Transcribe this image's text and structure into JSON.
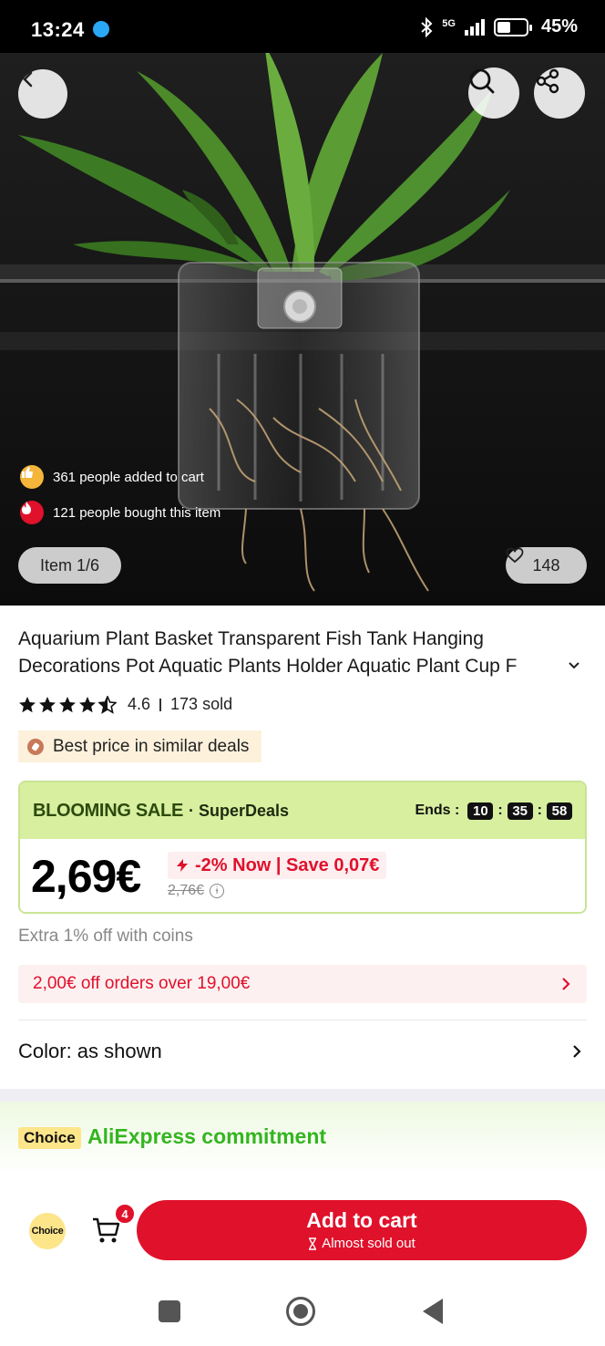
{
  "status_bar": {
    "time": "13:24",
    "network": "5G",
    "battery": "45%"
  },
  "gallery": {
    "social_proof": [
      {
        "icon": "thumbs-up-icon",
        "text": "361 people added to cart"
      },
      {
        "icon": "fire-icon",
        "text": "121 people bought this item"
      }
    ],
    "item_counter": "Item 1/6",
    "wishlist_count": "148"
  },
  "product": {
    "title": "Aquarium Plant Basket Transparent Fish Tank Hanging Decorations Pot Aquatic Plants Holder Aquatic Plant Cup F",
    "rating": "4.6",
    "rating_value": 4.6,
    "sold": "173 sold",
    "best_price_badge": "Best price in similar deals"
  },
  "sale": {
    "name": "BLOOMING SALE",
    "subtitle": "· SuperDeals",
    "ends_label": "Ends :",
    "timer": [
      "10",
      "35",
      "58"
    ],
    "price": "2,69€",
    "discount": "-2% Now | Save 0,07€",
    "old_price": "2,76€"
  },
  "offers": {
    "coins": "Extra 1% off with coins",
    "coupon": "2,00€ off orders over 19,00€"
  },
  "variant": {
    "color": "Color: as shown"
  },
  "commitment": {
    "tag": "Choice",
    "text": "AliExpress commitment"
  },
  "action_bar": {
    "choice_label": "Choice",
    "cart_count": "4",
    "add_to_cart": "Add to cart",
    "stock_note": "Almost sold out"
  },
  "colors": {
    "brand_red": "#e0112b",
    "sale_green": "#d7ef9f",
    "commit_green": "#34b520",
    "choice_yellow": "#fde58a"
  }
}
